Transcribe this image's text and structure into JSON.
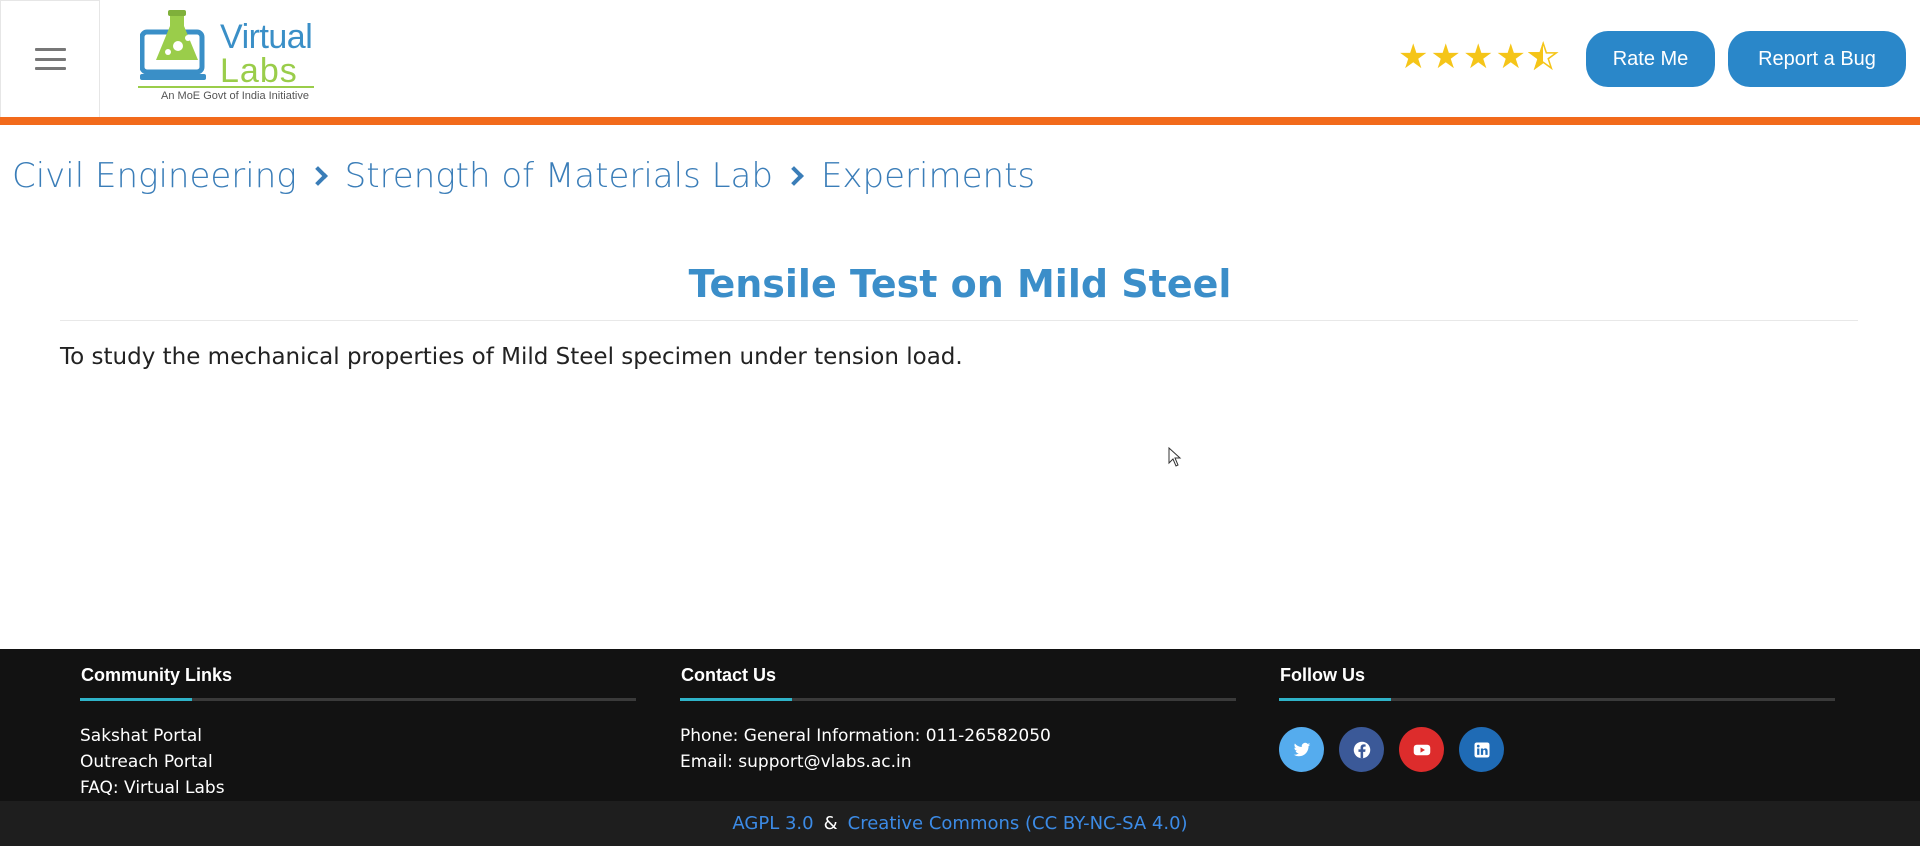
{
  "header": {
    "logo": {
      "word1": "Virtual",
      "word2": "Labs",
      "tagline": "An MoE Govt of India Initiative"
    },
    "rating": {
      "value": 4.5,
      "max": 5
    },
    "rate_label": "Rate Me",
    "bug_label": "Report a Bug"
  },
  "breadcrumb": {
    "items": [
      "Civil Engineering",
      "Strength of Materials Lab",
      "Experiments"
    ]
  },
  "main": {
    "title": "Tensile Test on Mild Steel",
    "aim": "To study the mechanical properties of Mild Steel specimen under tension load."
  },
  "footer": {
    "community": {
      "heading": "Community Links",
      "links": [
        "Sakshat Portal",
        "Outreach Portal",
        "FAQ: Virtual Labs"
      ]
    },
    "contact": {
      "heading": "Contact Us",
      "phone": "Phone: General Information: 011-26582050",
      "email": "Email: support@vlabs.ac.in"
    },
    "follow": {
      "heading": "Follow Us",
      "icons": [
        {
          "name": "twitter-icon",
          "color": "#55acee"
        },
        {
          "name": "facebook-icon",
          "color": "#3b5998"
        },
        {
          "name": "youtube-icon",
          "color": "#dd2c2c"
        },
        {
          "name": "linkedin-icon",
          "color": "#1f6bb5"
        }
      ]
    },
    "license_agpl": "AGPL 3.0",
    "amp": "&",
    "license_cc": "Creative Commons (CC BY-NC-SA 4.0)"
  },
  "colors": {
    "accent_blue": "#2a87c9",
    "orange_bar": "#f26a1b",
    "footer_bg": "#121212",
    "teal_rule": "#2fb3c8",
    "star": "#f5c518"
  }
}
